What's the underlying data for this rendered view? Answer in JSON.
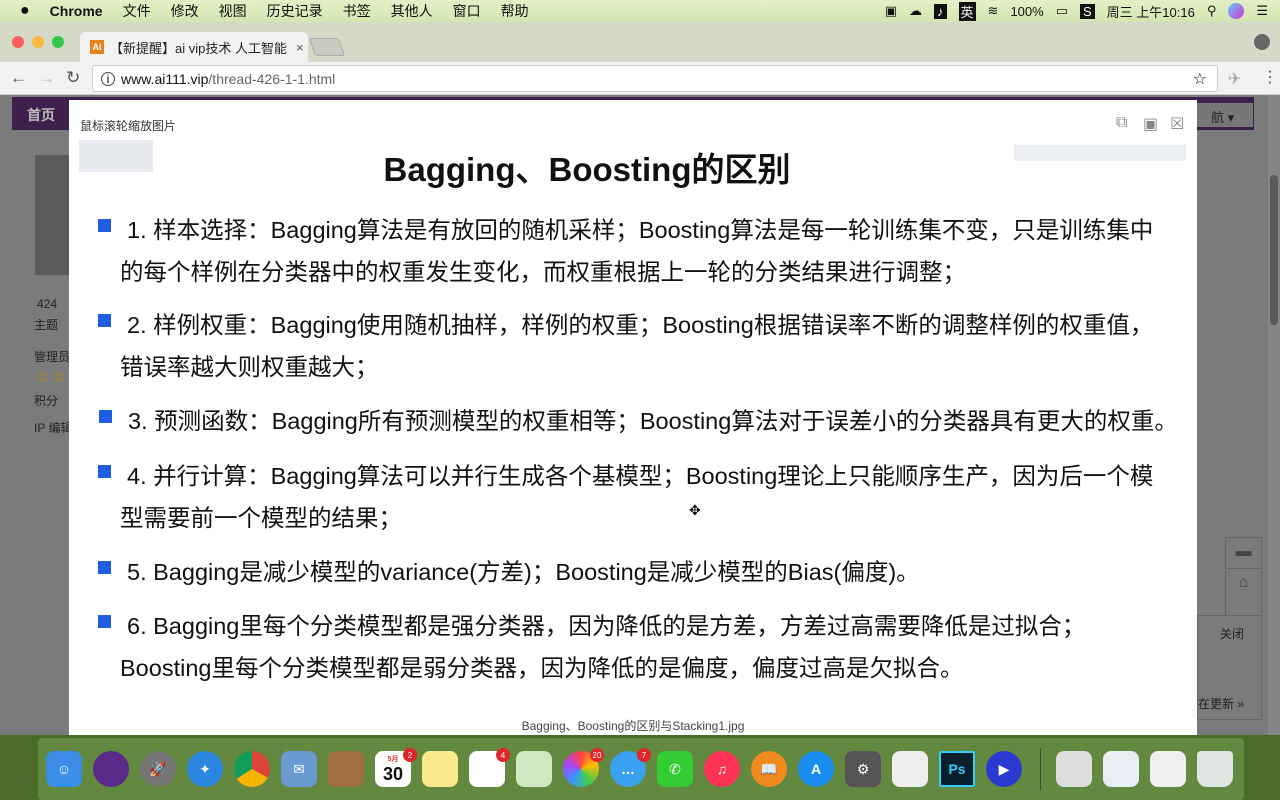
{
  "menubar": {
    "app": "Chrome",
    "items": [
      "文件",
      "修改",
      "视图",
      "历史记录",
      "书签",
      "其他人",
      "窗口",
      "帮助"
    ],
    "battery": "100%",
    "ime": "英",
    "clock": "周三 上午10:16"
  },
  "browser": {
    "tab_title": "【新提醒】ai vip技术 人工智能",
    "tab_favicon": "Ai",
    "url_host": "www.ai111.vip",
    "url_path": "/thread-426-1-1.html"
  },
  "page": {
    "nav_home": "首页",
    "nav_right": "航",
    "sidebar": {
      "count": "424",
      "count_label": "主题",
      "role": "管理员",
      "points": "积分",
      "ip_edit": "IP 编辑"
    },
    "close": "关闭",
    "more_updates": "在更新 »"
  },
  "modal": {
    "hint": "鼠标滚轮缩放图片",
    "title": "Bagging、Boosting的区别",
    "items": [
      [
        "1. 样本选择：Bagging算法是有放回的随机采样；Boosting算法是每一轮训练集不变，只是训练集中",
        "的每个样例在分类器中的权重发生变化，而权重根据上一轮的分类结果进行调整；"
      ],
      [
        "2. 样例权重：Bagging使用随机抽样，样例的权重；Boosting根据错误率不断的调整样例的权重值，",
        "错误率越大则权重越大；"
      ],
      [
        "3. 预测函数：Bagging所有预测模型的权重相等；Boosting算法对于误差小的分类器具有更大的权重。"
      ],
      [
        "4. 并行计算：Bagging算法可以并行生成各个基模型；Boosting理论上只能顺序生产，因为后一个模",
        "型需要前一个模型的结果；"
      ],
      [
        "5. Bagging是减少模型的variance(方差)；Boosting是减少模型的Bias(偏度)。"
      ],
      [
        "6. Bagging里每个分类模型都是强分类器，因为降低的是方差，方差过高需要降低是过拟合；",
        "Boosting里每个分类模型都是弱分类器，因为降低的是偏度，偏度过高是欠拟合。"
      ]
    ],
    "caption": "Bagging、Boosting的区别与Stacking1.jpg"
  },
  "dock": {
    "calendar_day": "30",
    "calendar_month": "5月",
    "calendar_badge": "2",
    "reminders_badge": "4",
    "photos_badge": "20",
    "messages_badge": "7",
    "ps": "Ps"
  },
  "colors": {
    "bullet": "#1f5ee0",
    "nav": "#3f1f4c"
  }
}
